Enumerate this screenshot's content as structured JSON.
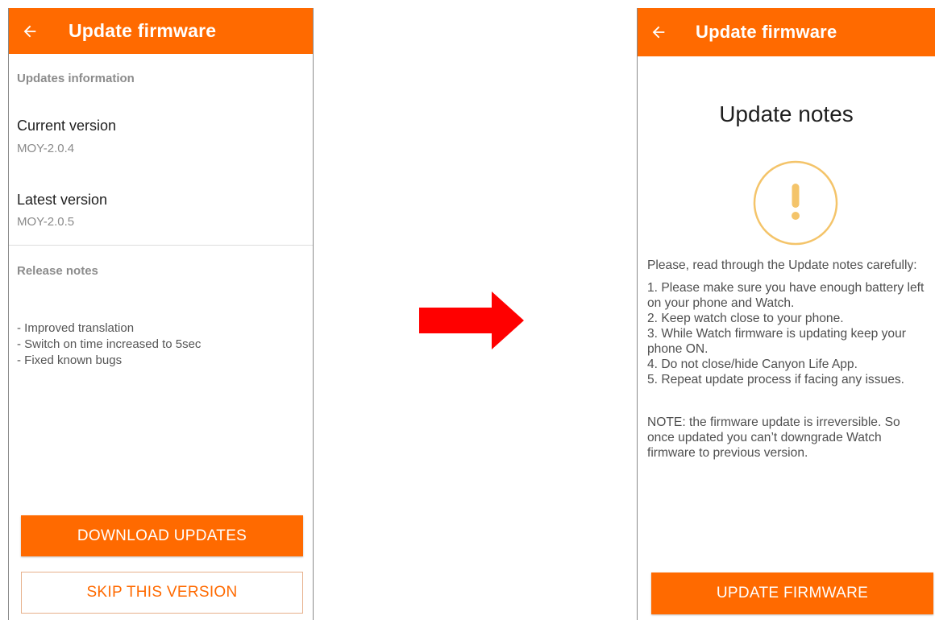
{
  "left_screen": {
    "appbar": {
      "title": "Update firmware",
      "back_icon": "arrow-left-icon"
    },
    "updates_information": {
      "header": "Updates information",
      "current_version": {
        "label": "Current version",
        "value": "MOY-2.0.4"
      },
      "latest_version": {
        "label": "Latest version",
        "value": "MOY-2.0.5"
      }
    },
    "release_notes": {
      "header": "Release notes",
      "items": [
        "- Improved translation",
        "- Switch on time increased to 5sec",
        "- Fixed known bugs"
      ]
    },
    "buttons": {
      "download": "DOWNLOAD UPDATES",
      "skip": "SKIP THIS VERSION"
    }
  },
  "transition": {
    "icon": "right-arrow-icon",
    "color": "#ff0000"
  },
  "right_screen": {
    "appbar": {
      "title": "Update firmware",
      "back_icon": "arrow-left-icon"
    },
    "heading": "Update notes",
    "warning_icon": "exclamation-circle-icon",
    "intro": "Please, read through the Update notes carefully:",
    "steps": [
      "1. Please make sure you have enough battery left on your phone and Watch.",
      "2. Keep watch close to your phone.",
      "3. While Watch firmware is updating keep your phone ON.",
      "4. Do not close/hide Canyon Life App.",
      "5. Repeat update process if facing any issues."
    ],
    "note": "NOTE: the firmware update is irreversible. So once updated you can’t downgrade Watch firmware to previous version.",
    "button": "UPDATE FIRMWARE"
  },
  "colors": {
    "accent": "#ff6a00",
    "warning": "#f4c46a",
    "arrow": "#ff0000"
  }
}
